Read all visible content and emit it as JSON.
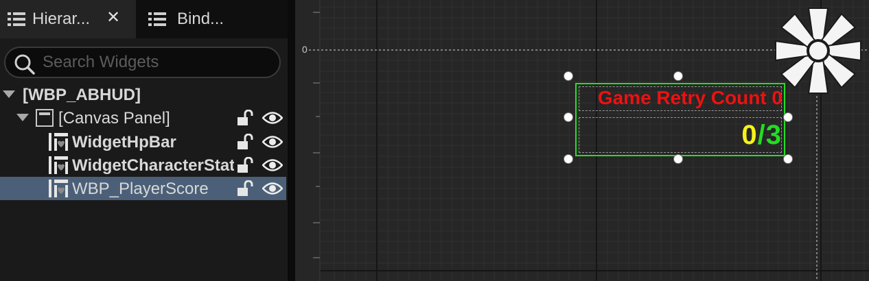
{
  "tabs": [
    {
      "label": "Hierar...",
      "icon": "hierarchy-list-icon",
      "active": true,
      "close_glyph": "✕"
    },
    {
      "label": "Bind...",
      "icon": "bind-list-icon",
      "active": false
    }
  ],
  "search": {
    "placeholder": "Search Widgets",
    "value": ""
  },
  "tree": {
    "root": {
      "label": "[WBP_ABHUD]",
      "expanded": true
    },
    "canvas": {
      "label": "[Canvas Panel]",
      "expanded": true
    },
    "items": [
      {
        "label": "WidgetHpBar",
        "selected": false
      },
      {
        "label": "WidgetCharacterStat",
        "selected": false
      },
      {
        "label": "WBP_PlayerScore",
        "selected": true
      }
    ]
  },
  "designer": {
    "ruler_zero": "0",
    "retry_text": "Game Retry Count 0",
    "score": {
      "current": "0",
      "separator": "/",
      "max": "3"
    }
  },
  "colors": {
    "selection": "#4b6078",
    "widget_outline": "#22e022",
    "retry_text": "#ee1111",
    "score_current": "#f3f31a",
    "score_max": "#22dd22"
  }
}
